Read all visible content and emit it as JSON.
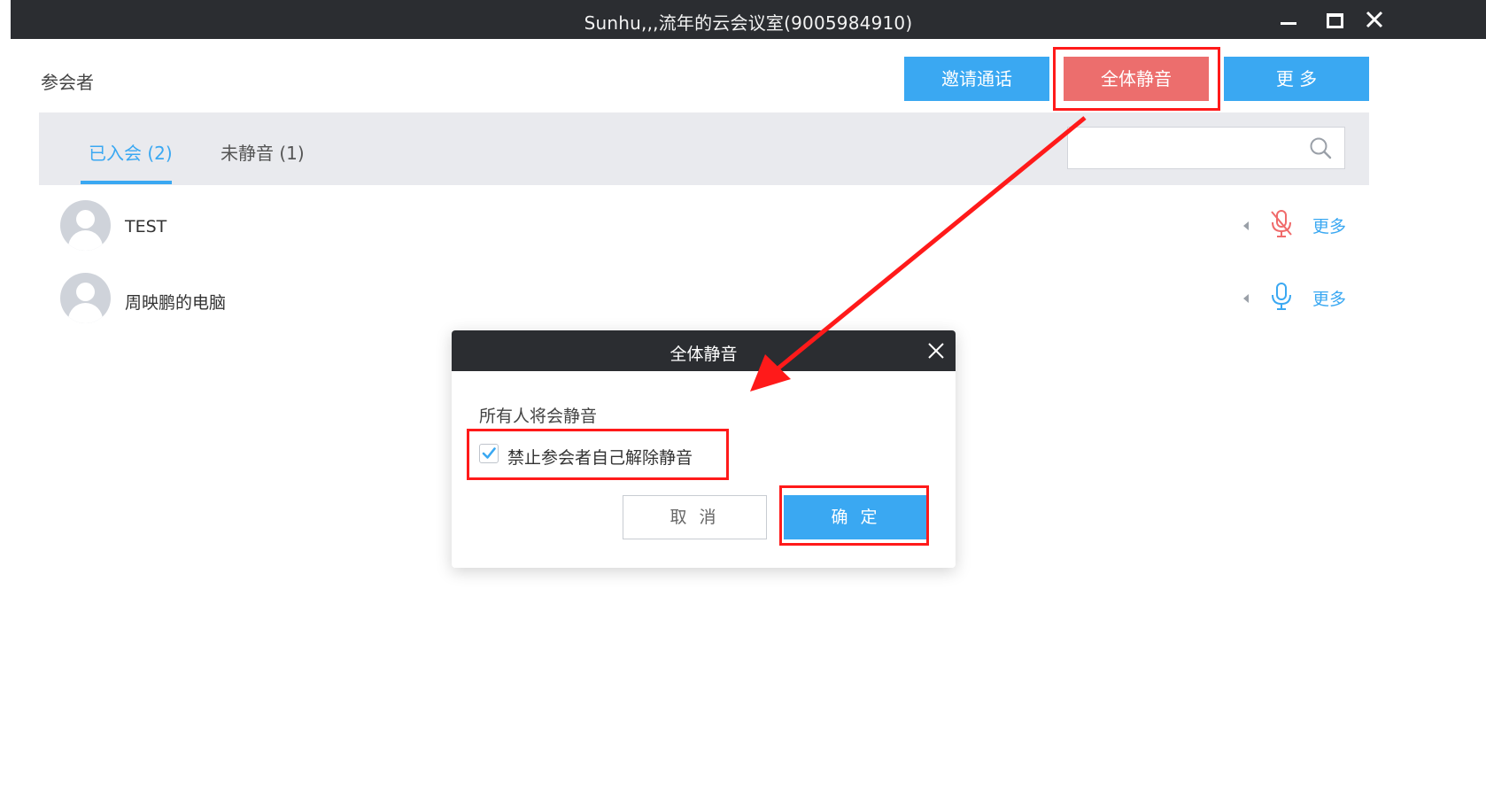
{
  "window": {
    "title": "Sunhu,,,流年的云会议室(9005984910)"
  },
  "header": {
    "section_title": "参会者",
    "invite_label": "邀请通话",
    "mute_all_label": "全体静音",
    "more_label": "更 多"
  },
  "tabs": [
    {
      "label": "已入会 (2)",
      "active": true
    },
    {
      "label": "未静音 (1)",
      "active": false
    }
  ],
  "search": {
    "value": "",
    "placeholder": ""
  },
  "participants": [
    {
      "name": "TEST",
      "mic": "muted-mic-icon",
      "more_label": "更多"
    },
    {
      "name": "周映鹏的电脑",
      "mic": "mic-icon",
      "more_label": "更多"
    }
  ],
  "dialog": {
    "title": "全体静音",
    "message": "所有人将会静音",
    "checkbox_label": "禁止参会者自己解除静音",
    "checkbox_checked": true,
    "cancel_label": "取 消",
    "confirm_label": "确 定"
  },
  "colors": {
    "accent": "#3aa8f2",
    "mute_all": "#ec6e6d",
    "titlebar": "#2b2d31",
    "highlight": "#ff1a1a"
  }
}
